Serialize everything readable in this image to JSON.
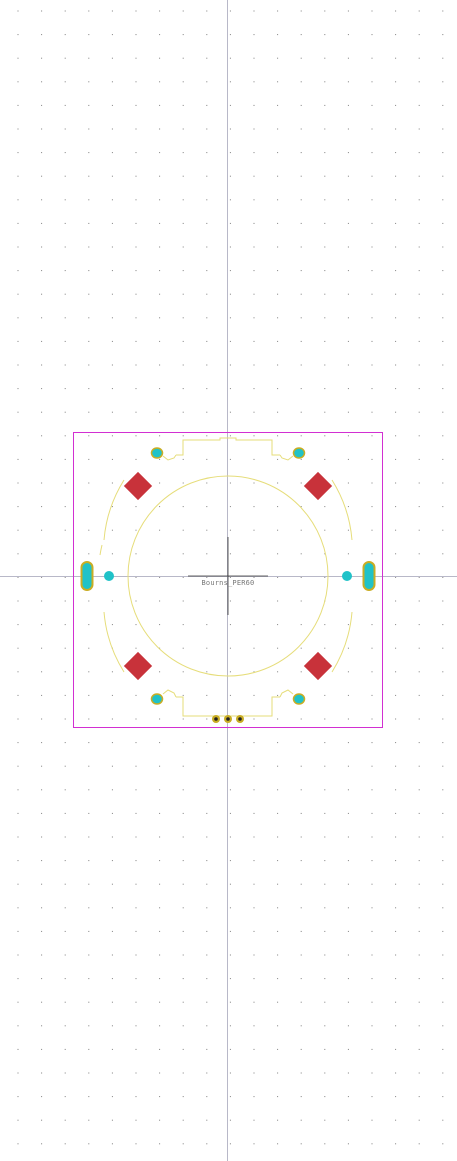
{
  "footprint": {
    "reference_label": "Bourns_PER60"
  },
  "colors": {
    "background": "#ffffff",
    "grid_dot": "#7f7f7f",
    "axis_line": "#b8b8c8",
    "courtyard": "#d22fd2",
    "silkscreen": "#e6dd7a",
    "smd_pad": "#c8323a",
    "tht_pad": "#20c2c8",
    "pad_ring": "#c9ad24",
    "origin_cross": "#333333",
    "label_text": "#777777"
  }
}
